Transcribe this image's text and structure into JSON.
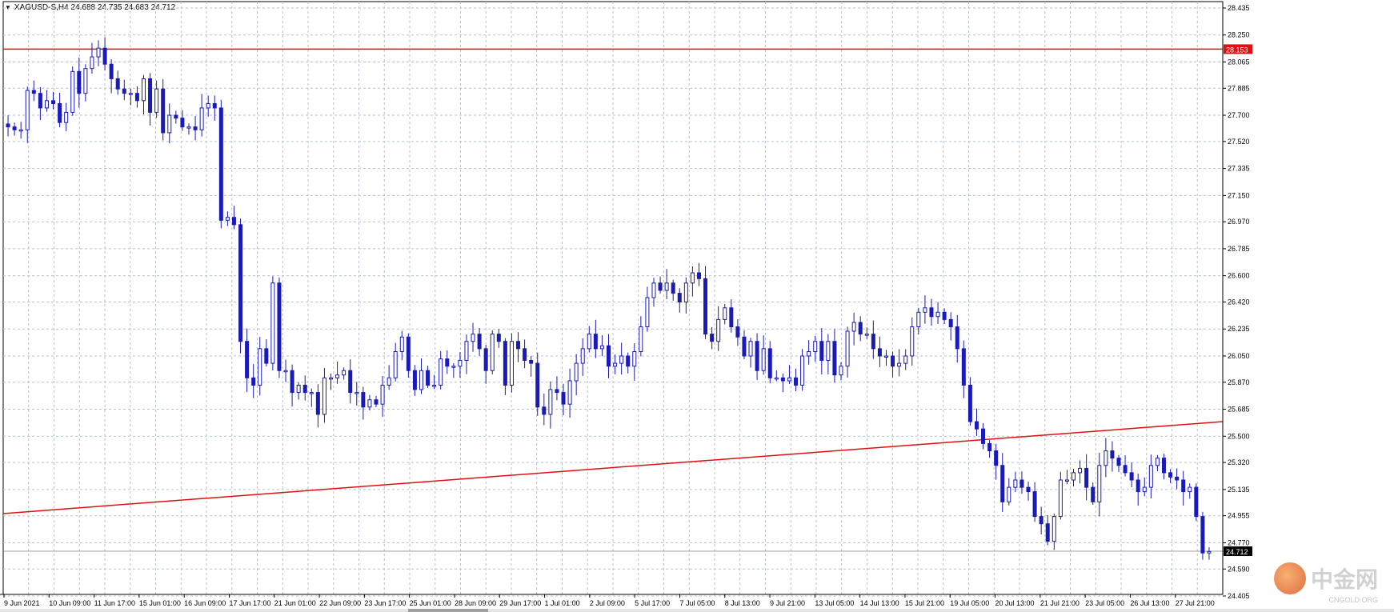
{
  "header": {
    "symbol_line": "XAGUSD-S,H4  24.688 24.735 24.683 24.712"
  },
  "watermark": {
    "brand": "中金网",
    "domain": "CNGOLD.ORG"
  },
  "colors": {
    "candle": "#1a1ab8",
    "grid": "#b8c2cc",
    "resistance": "#e01010",
    "trendline": "#e01010",
    "current_price_bg": "#000000",
    "resistance_label_bg": "#e01010"
  },
  "chart_data": {
    "type": "candlestick",
    "symbol": "XAGUSD-S",
    "timeframe": "H4",
    "ylim": [
      24.4,
      28.5
    ],
    "y_ticks": [
      "28.435",
      "28.250",
      "28.065",
      "27.885",
      "27.700",
      "27.520",
      "27.335",
      "27.150",
      "26.970",
      "26.785",
      "26.600",
      "26.420",
      "26.235",
      "26.050",
      "25.870",
      "25.685",
      "25.500",
      "25.320",
      "25.135",
      "24.955",
      "24.770",
      "24.590",
      "24.405"
    ],
    "x_labels": [
      "9 Jun 2021",
      "10 Jun 09:00",
      "11 Jun 17:00",
      "15 Jun 01:00",
      "16 Jun 09:00",
      "17 Jun 17:00",
      "21 Jun 01:00",
      "22 Jun 09:00",
      "23 Jun 17:00",
      "25 Jun 01:00",
      "28 Jun 09:00",
      "29 Jun 17:00",
      "1 Jul 01:00",
      "2 Jul 09:00",
      "5 Jul 17:00",
      "7 Jul 05:00",
      "8 Jul 13:00",
      "9 Jul 21:00",
      "13 Jul 05:00",
      "14 Jul 13:00",
      "15 Jul 21:00",
      "19 Jul 05:00",
      "20 Jul 13:00",
      "21 Jul 21:00",
      "23 Jul 05:00",
      "26 Jul 13:00",
      "27 Jul 21:00"
    ],
    "horizontal_line": {
      "price": 28.153,
      "label": "28.153"
    },
    "current_price": {
      "price": 24.712,
      "label": "24.712"
    },
    "trendline": {
      "start_price": 24.97,
      "end_price": 25.6
    },
    "closes": [
      27.62,
      27.6,
      27.6,
      27.87,
      27.85,
      27.75,
      27.8,
      27.78,
      27.65,
      27.72,
      28.0,
      27.85,
      28.02,
      28.1,
      28.16,
      28.05,
      27.95,
      27.88,
      27.85,
      27.85,
      27.8,
      27.95,
      27.72,
      27.88,
      27.58,
      27.7,
      27.68,
      27.62,
      27.62,
      27.6,
      27.75,
      27.78,
      27.75,
      26.98,
      27.0,
      26.95,
      26.15,
      25.9,
      25.85,
      26.1,
      26.0,
      26.55,
      25.95,
      25.95,
      25.8,
      25.85,
      25.8,
      25.8,
      25.65,
      25.9,
      25.9,
      25.92,
      25.95,
      25.8,
      25.8,
      25.7,
      25.75,
      25.72,
      25.85,
      25.9,
      26.08,
      26.18,
      25.95,
      25.82,
      25.95,
      25.85,
      25.85,
      26.03,
      25.98,
      25.98,
      26.02,
      26.15,
      26.2,
      26.1,
      25.95,
      26.2,
      26.15,
      25.85,
      26.15,
      26.1,
      26.02,
      26.0,
      25.7,
      25.65,
      25.82,
      25.8,
      25.72,
      25.88,
      26.0,
      26.1,
      26.2,
      26.1,
      26.12,
      25.98,
      26.0,
      26.05,
      25.98,
      26.08,
      26.25,
      26.45,
      26.55,
      26.5,
      26.55,
      26.48,
      26.42,
      26.55,
      26.62,
      26.58,
      26.2,
      26.15,
      26.3,
      26.38,
      26.25,
      26.18,
      26.05,
      26.15,
      25.95,
      26.1,
      25.9,
      25.9,
      25.88,
      25.9,
      25.85,
      26.05,
      26.08,
      26.15,
      26.02,
      26.15,
      25.92,
      25.98,
      26.22,
      26.28,
      26.2,
      26.2,
      26.1,
      26.05,
      26.05,
      25.98,
      26.0,
      26.05,
      26.25,
      26.35,
      26.38,
      26.32,
      26.35,
      26.3,
      26.25,
      26.1,
      25.85,
      25.6,
      25.55,
      25.45,
      25.4,
      25.3,
      25.05,
      25.15,
      25.2,
      25.15,
      25.12,
      24.95,
      24.9,
      24.78,
      24.95,
      25.2,
      25.2,
      25.25,
      25.28,
      25.15,
      25.05,
      25.3,
      25.4,
      25.35,
      25.3,
      25.25,
      25.2,
      25.12,
      25.15,
      25.3,
      25.35,
      25.25,
      25.22,
      25.2,
      25.12,
      25.15,
      24.95,
      24.7,
      24.71
    ]
  }
}
